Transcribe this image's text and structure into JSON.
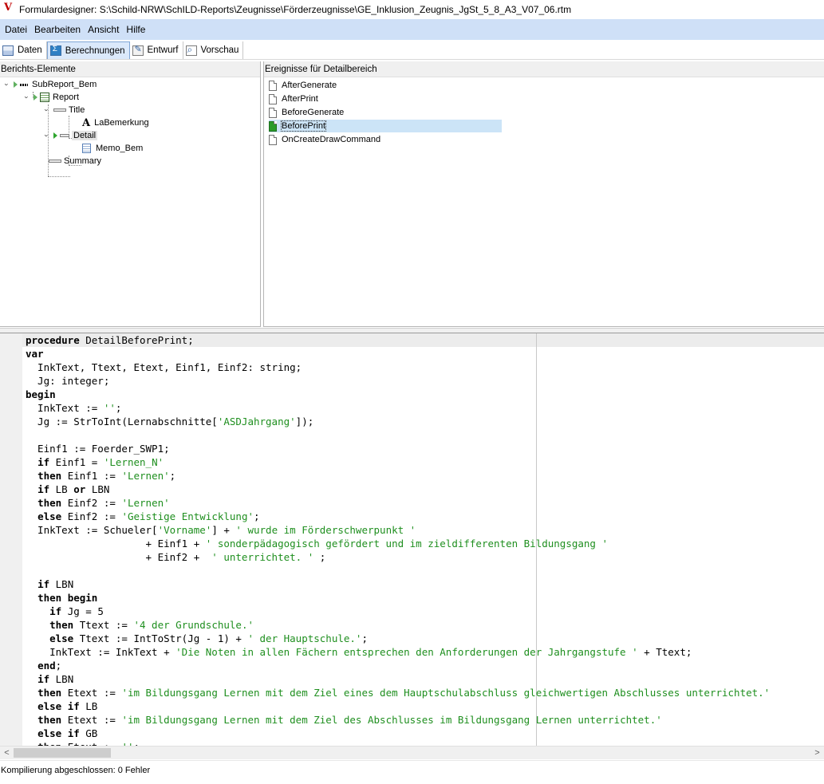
{
  "window": {
    "title": "Formulardesigner: S:\\Schild-NRW\\SchILD-Reports\\Zeugnisse\\Förderzeugnisse\\GE_Inklusion_Zeugnis_JgSt_5_8_A3_V07_06.rtm"
  },
  "menu": {
    "items": [
      "Datei",
      "Bearbeiten",
      "Ansicht",
      "Hilfe"
    ]
  },
  "tabs": [
    {
      "label": "Daten",
      "icon": "data-icon"
    },
    {
      "label": "Berechnungen",
      "icon": "calculations-icon",
      "active": true
    },
    {
      "label": "Entwurf",
      "icon": "design-icon"
    },
    {
      "label": "Vorschau",
      "icon": "preview-icon"
    }
  ],
  "left_pane": {
    "header": "Berichts-Elemente",
    "tree": {
      "subreport": "SubReport_Bem",
      "report": "Report",
      "title": "Title",
      "label": "LaBemerkung",
      "detail": "Detail",
      "memo": "Memo_Bem",
      "summary": "Summary"
    }
  },
  "right_pane": {
    "header": "Ereignisse für Detailbereich",
    "events": [
      "AfterGenerate",
      "AfterPrint",
      "BeforeGenerate",
      "BeforePrint",
      "OnCreateDrawCommand"
    ],
    "selected": "BeforePrint"
  },
  "code": [
    [
      {
        "t": "procedure",
        "k": "kw"
      },
      {
        "t": " DetailBeforePrint;",
        "k": ""
      }
    ],
    [
      {
        "t": "var",
        "k": "kw"
      }
    ],
    [
      {
        "t": "  InkText, Ttext, Etext, Einf1, Einf2: string;",
        "k": ""
      }
    ],
    [
      {
        "t": "  Jg: integer;",
        "k": ""
      }
    ],
    [
      {
        "t": "begin",
        "k": "kw"
      }
    ],
    [
      {
        "t": "  InkText := ",
        "k": ""
      },
      {
        "t": "''",
        "k": "str"
      },
      {
        "t": ";",
        "k": ""
      }
    ],
    [
      {
        "t": "  Jg := StrToInt(Lernabschnitte[",
        "k": ""
      },
      {
        "t": "'ASDJahrgang'",
        "k": "str"
      },
      {
        "t": "]);",
        "k": ""
      }
    ],
    [
      {
        "t": "",
        "k": ""
      }
    ],
    [
      {
        "t": "  Einf1 := Foerder_SWP1;",
        "k": ""
      }
    ],
    [
      {
        "t": "  ",
        "k": ""
      },
      {
        "t": "if",
        "k": "kw"
      },
      {
        "t": " Einf1 = ",
        "k": ""
      },
      {
        "t": "'Lernen_N'",
        "k": "str"
      }
    ],
    [
      {
        "t": "  ",
        "k": ""
      },
      {
        "t": "then",
        "k": "kw"
      },
      {
        "t": " Einf1 := ",
        "k": ""
      },
      {
        "t": "'Lernen'",
        "k": "str"
      },
      {
        "t": ";",
        "k": ""
      }
    ],
    [
      {
        "t": "  ",
        "k": ""
      },
      {
        "t": "if",
        "k": "kw"
      },
      {
        "t": " LB ",
        "k": ""
      },
      {
        "t": "or",
        "k": "kw"
      },
      {
        "t": " LBN",
        "k": ""
      }
    ],
    [
      {
        "t": "  ",
        "k": ""
      },
      {
        "t": "then",
        "k": "kw"
      },
      {
        "t": " Einf2 := ",
        "k": ""
      },
      {
        "t": "'Lernen'",
        "k": "str"
      }
    ],
    [
      {
        "t": "  ",
        "k": ""
      },
      {
        "t": "else",
        "k": "kw"
      },
      {
        "t": " Einf2 := ",
        "k": ""
      },
      {
        "t": "'Geistige Entwicklung'",
        "k": "str"
      },
      {
        "t": ";",
        "k": ""
      }
    ],
    [
      {
        "t": "  InkText := Schueler[",
        "k": ""
      },
      {
        "t": "'Vorname'",
        "k": "str"
      },
      {
        "t": "] + ",
        "k": ""
      },
      {
        "t": "' wurde im Förderschwerpunkt '",
        "k": "str"
      }
    ],
    [
      {
        "t": "                    + Einf1 + ",
        "k": ""
      },
      {
        "t": "' sonderpädagogisch gefördert und im zieldifferenten Bildungsgang '",
        "k": "str"
      }
    ],
    [
      {
        "t": "                    + Einf2 +  ",
        "k": ""
      },
      {
        "t": "' unterrichtet. '",
        "k": "str"
      },
      {
        "t": " ;",
        "k": ""
      }
    ],
    [
      {
        "t": "",
        "k": ""
      }
    ],
    [
      {
        "t": "  ",
        "k": ""
      },
      {
        "t": "if",
        "k": "kw"
      },
      {
        "t": " LBN",
        "k": ""
      }
    ],
    [
      {
        "t": "  ",
        "k": ""
      },
      {
        "t": "then begin",
        "k": "kw"
      }
    ],
    [
      {
        "t": "    ",
        "k": ""
      },
      {
        "t": "if",
        "k": "kw"
      },
      {
        "t": " Jg = 5",
        "k": ""
      }
    ],
    [
      {
        "t": "    ",
        "k": ""
      },
      {
        "t": "then",
        "k": "kw"
      },
      {
        "t": " Ttext := ",
        "k": ""
      },
      {
        "t": "'4 der Grundschule.'",
        "k": "str"
      }
    ],
    [
      {
        "t": "    ",
        "k": ""
      },
      {
        "t": "else",
        "k": "kw"
      },
      {
        "t": " Ttext := IntToStr(Jg - 1) + ",
        "k": ""
      },
      {
        "t": "' der Hauptschule.'",
        "k": "str"
      },
      {
        "t": ";",
        "k": ""
      }
    ],
    [
      {
        "t": "    InkText := InkText + ",
        "k": ""
      },
      {
        "t": "'Die Noten in allen Fächern entsprechen den Anforderungen der Jahrgangstufe '",
        "k": "str"
      },
      {
        "t": " + Ttext;",
        "k": ""
      }
    ],
    [
      {
        "t": "  ",
        "k": ""
      },
      {
        "t": "end",
        "k": "kw"
      },
      {
        "t": ";",
        "k": ""
      }
    ],
    [
      {
        "t": "  ",
        "k": ""
      },
      {
        "t": "if",
        "k": "kw"
      },
      {
        "t": " LBN",
        "k": ""
      }
    ],
    [
      {
        "t": "  ",
        "k": ""
      },
      {
        "t": "then",
        "k": "kw"
      },
      {
        "t": " Etext := ",
        "k": ""
      },
      {
        "t": "'im Bildungsgang Lernen mit dem Ziel eines dem Hauptschulabschluss gleichwertigen Abschlusses unterrichtet.'",
        "k": "str"
      }
    ],
    [
      {
        "t": "  ",
        "k": ""
      },
      {
        "t": "else if",
        "k": "kw"
      },
      {
        "t": " LB",
        "k": ""
      }
    ],
    [
      {
        "t": "  ",
        "k": ""
      },
      {
        "t": "then",
        "k": "kw"
      },
      {
        "t": " Etext := ",
        "k": ""
      },
      {
        "t": "'im Bildungsgang Lernen mit dem Ziel des Abschlusses im Bildungsgang Lernen unterrichtet.'",
        "k": "str"
      }
    ],
    [
      {
        "t": "  ",
        "k": ""
      },
      {
        "t": "else if",
        "k": "kw"
      },
      {
        "t": " GB",
        "k": ""
      }
    ],
    [
      {
        "t": "  ",
        "k": ""
      },
      {
        "t": "then",
        "k": "kw"
      },
      {
        "t": " Etext := ",
        "k": ""
      },
      {
        "t": "''",
        "k": "str"
      },
      {
        "t": ";",
        "k": ""
      }
    ]
  ],
  "status": {
    "text": "Kompilierung abgeschlossen: 0 Fehler"
  }
}
